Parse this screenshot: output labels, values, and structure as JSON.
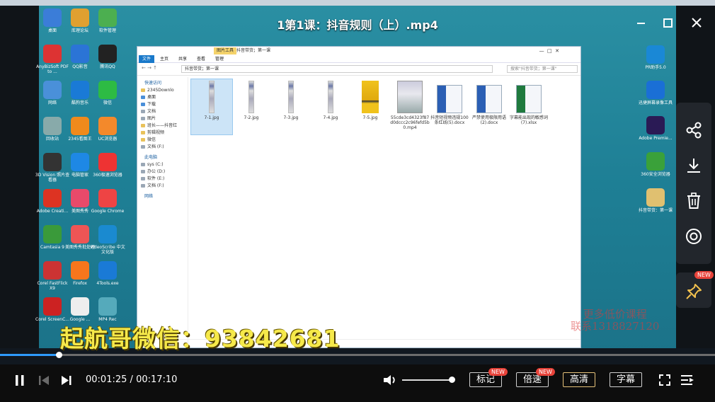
{
  "player": {
    "title": "1第1课：抖音规则（上）.mp4",
    "time_current": "00:01:25",
    "time_separator": "/",
    "time_total": "00:17:10",
    "progress": 0.0825,
    "volume": 0.95,
    "buttons": {
      "mark": "标记",
      "speed": "倍速",
      "quality": "高清",
      "subtitle": "字幕"
    },
    "badges": {
      "mark_new": "NEW",
      "speed_new": "NEW",
      "pin_new": "NEW"
    },
    "colors": {
      "accent": "#2e9bff",
      "badge": "#e8433a",
      "quality_border": "#e6c27a"
    }
  },
  "recording": {
    "watermark_wechat": "起航哥微信：93842681",
    "watermark_promo_line1": "更多低价课程",
    "watermark_promo_line2": "联系1318827120",
    "desktop_icons_left": [
      {
        "label": "桌面",
        "color": "#3b7dd8"
      },
      {
        "label": "库理论坛",
        "color": "#e0a030"
      },
      {
        "label": "软件管理",
        "color": "#4caf50"
      },
      {
        "label": "AnyBizSoft PDF to ...",
        "color": "#d33"
      },
      {
        "label": "QQ影音",
        "color": "#2b74d6"
      },
      {
        "label": "腾讯QQ",
        "color": "#222"
      },
      {
        "label": "网络",
        "color": "#4a90d9"
      },
      {
        "label": "酷狗音乐",
        "color": "#1a7ad6"
      },
      {
        "label": "微信",
        "color": "#2dbb44"
      },
      {
        "label": "回收站",
        "color": "#8aa"
      },
      {
        "label": "2345看图王",
        "color": "#f08a1c"
      },
      {
        "label": "UC浏览器",
        "color": "#f3892b"
      },
      {
        "label": "3D Vision 照片查看器",
        "color": "#333"
      },
      {
        "label": "电脑管家",
        "color": "#1e88e5"
      },
      {
        "label": "360极速浏览器",
        "color": "#e33"
      },
      {
        "label": "Adobe Creati...",
        "color": "#d32"
      },
      {
        "label": "美图秀秀",
        "color": "#e84a6a"
      },
      {
        "label": "Google Chrome",
        "color": "#e44"
      },
      {
        "label": "Camtasia 9",
        "color": "#3a9a3a"
      },
      {
        "label": "美图秀秀批处理",
        "color": "#e55"
      },
      {
        "label": "VideoScribe 中文文化版",
        "color": "#1a8ad0"
      },
      {
        "label": "Corel FastFlick X9",
        "color": "#c33"
      },
      {
        "label": "Firefox",
        "color": "#f7761c"
      },
      {
        "label": "4Tools.exe",
        "color": "#1a7ad6"
      },
      {
        "label": "Corel ScreenC...",
        "color": "#c22"
      },
      {
        "label": "Google ...",
        "color": "#eee"
      },
      {
        "label": "MP4 Rec",
        "color": "#5ab"
      }
    ],
    "desktop_icons_right": [
      {
        "label": "PR助手5.0",
        "color": "#1a88d6"
      },
      {
        "label": "迅捷屏幕录像工具",
        "color": "#1a6fd6"
      },
      {
        "label": "Adobe Premie...",
        "color": "#2a1a55"
      },
      {
        "label": "360安全浏览器",
        "color": "#3aa13a"
      },
      {
        "label": "抖音带货：第一课",
        "color": "#e0c070"
      }
    ],
    "explorer": {
      "window_title": "抖音带货；第一课",
      "context_tab": "图片工具",
      "ribbon_tabs": [
        "文件",
        "主页",
        "共享",
        "查看",
        "管理"
      ],
      "address": "抖音带货；第一课",
      "search_placeholder": "搜索\"抖音带货；第一课\"",
      "nav_quick_access": "快速访问",
      "nav_items": [
        {
          "label": "2345Downlo",
          "kind": "folder"
        },
        {
          "label": "桌面",
          "kind": "blue"
        },
        {
          "label": "下载",
          "kind": "blue"
        },
        {
          "label": "文档",
          "kind": "drive"
        },
        {
          "label": "图片",
          "kind": "drive"
        },
        {
          "label": "班长——抖音红",
          "kind": "folder"
        },
        {
          "label": "剪辑视频",
          "kind": "folder"
        },
        {
          "label": "微信",
          "kind": "folder"
        },
        {
          "label": "文档 (F:)",
          "kind": "drive"
        }
      ],
      "nav_this_pc": "此电脑",
      "nav_drives": [
        {
          "label": "sys (C:)"
        },
        {
          "label": "办公 (D:)"
        },
        {
          "label": "软件 (E:)"
        },
        {
          "label": "文档 (F:)"
        }
      ],
      "nav_network": "网络",
      "files": [
        {
          "name": "7-1.jpg",
          "type": "tall-image",
          "selected": true
        },
        {
          "name": "7-2.jpg",
          "type": "tall-image",
          "selected": false
        },
        {
          "name": "7-3.jpg",
          "type": "tall-image",
          "selected": false
        },
        {
          "name": "7-4.jpg",
          "type": "tall-image",
          "selected": false
        },
        {
          "name": "7-5.jpg",
          "type": "yellow-image",
          "selected": false
        },
        {
          "name": "55cde3cd4323f87d0dccc2c96fefd5b0.mp4",
          "type": "video",
          "selected": false
        },
        {
          "name": "抖音短视频违规100条红线(5).docx",
          "type": "docx",
          "selected": false
        },
        {
          "name": "严禁使用极限用语(2).docx",
          "type": "docx",
          "selected": false
        },
        {
          "name": "字幕能出现的敏感词(7).xlsx",
          "type": "xlsx",
          "selected": false
        }
      ]
    }
  }
}
